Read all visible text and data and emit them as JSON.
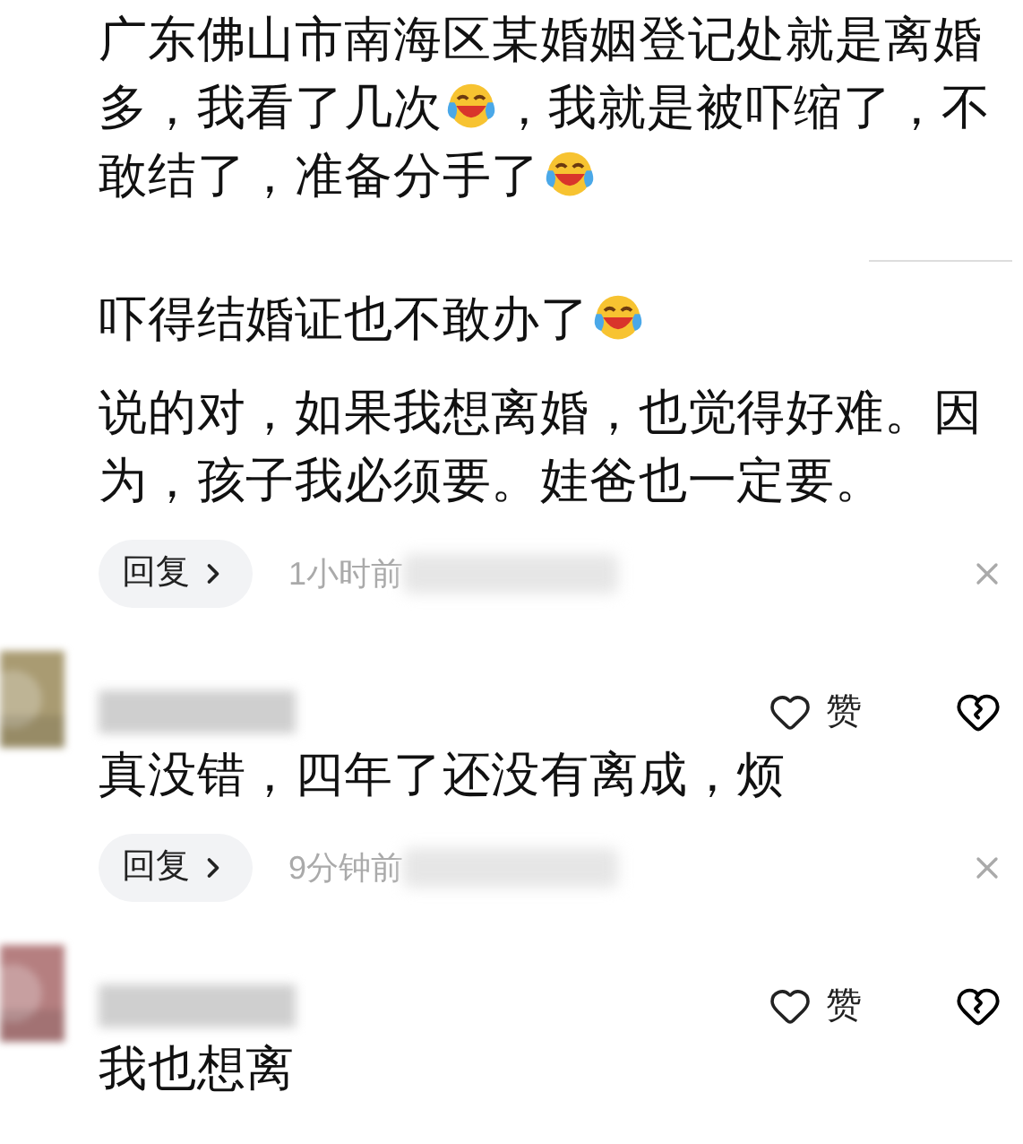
{
  "comments": [
    {
      "kind": "plain",
      "separated": false,
      "body": [
        {
          "kind": "text",
          "text": "广东佛山市南海区某婚姻登记处就是离婚多，我看了几次"
        },
        {
          "kind": "emoji"
        },
        {
          "kind": "text",
          "text": "，我就是被吓缩了，不敢结了，准备分手了"
        },
        {
          "kind": "emoji"
        }
      ]
    },
    {
      "kind": "plain",
      "separated": true,
      "body": [
        {
          "kind": "text",
          "text": "吓得结婚证也不敢办了"
        },
        {
          "kind": "emoji"
        }
      ]
    },
    {
      "kind": "plain",
      "separated": false,
      "body": [
        {
          "kind": "text",
          "text": "说的对，如果我想离婚，也觉得好难。因为，孩子我必须要。娃爸也一定要。"
        }
      ],
      "footer": {
        "reply": "回复",
        "time": "1小时前"
      }
    },
    {
      "kind": "full",
      "separated": false,
      "header": {
        "like": "赞"
      },
      "body": [
        {
          "kind": "text",
          "text": "真没错，四年了还没有离成，烦"
        }
      ],
      "footer": {
        "reply": "回复",
        "time": "9分钟前"
      }
    },
    {
      "kind": "full",
      "separated": false,
      "header": {
        "like": "赞"
      },
      "body": [
        {
          "kind": "text",
          "text": "我也想离"
        }
      ]
    }
  ]
}
